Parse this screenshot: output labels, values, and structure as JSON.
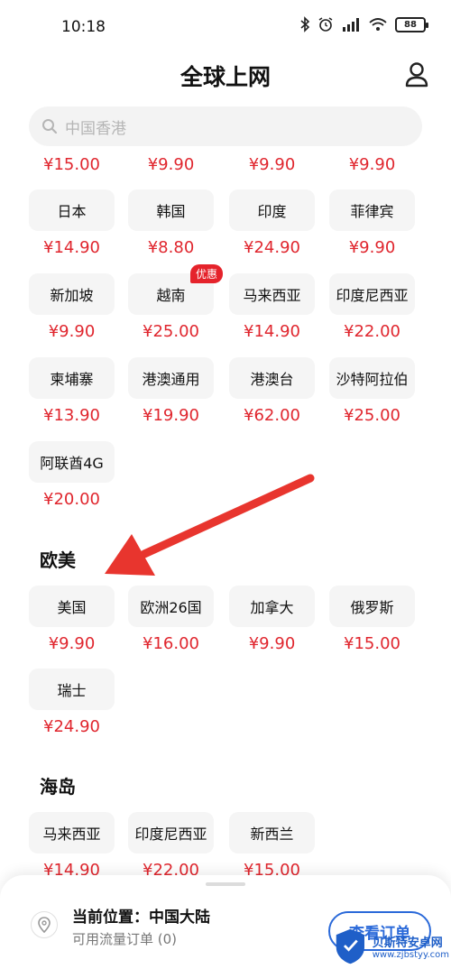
{
  "status_bar": {
    "time": "10:18",
    "battery": "88"
  },
  "header": {
    "title": "全球上网"
  },
  "search": {
    "placeholder": "中国香港"
  },
  "top_prices": [
    "¥15.00",
    "¥9.90",
    "¥9.90",
    "¥9.90"
  ],
  "asia_rows": [
    [
      {
        "name": "日本",
        "price": "¥14.90"
      },
      {
        "name": "韩国",
        "price": "¥8.80"
      },
      {
        "name": "印度",
        "price": "¥24.90"
      },
      {
        "name": "菲律宾",
        "price": "¥9.90"
      }
    ],
    [
      {
        "name": "新加坡",
        "price": "¥9.90"
      },
      {
        "name": "越南",
        "price": "¥25.00",
        "badge": "优惠"
      },
      {
        "name": "马来西亚",
        "price": "¥14.90"
      },
      {
        "name": "印度尼西亚",
        "price": "¥22.00"
      }
    ],
    [
      {
        "name": "柬埔寨",
        "price": "¥13.90"
      },
      {
        "name": "港澳通用",
        "price": "¥19.90"
      },
      {
        "name": "港澳台",
        "price": "¥62.00"
      },
      {
        "name": "沙特阿拉伯",
        "price": "¥25.00"
      }
    ],
    [
      {
        "name": "阿联酋4G",
        "price": "¥20.00"
      }
    ]
  ],
  "europe": {
    "title": "欧美",
    "rows": [
      [
        {
          "name": "美国",
          "price": "¥9.90"
        },
        {
          "name": "欧洲26国",
          "price": "¥16.00"
        },
        {
          "name": "加拿大",
          "price": "¥9.90"
        },
        {
          "name": "俄罗斯",
          "price": "¥15.00"
        }
      ],
      [
        {
          "name": "瑞士",
          "price": "¥24.90"
        }
      ]
    ]
  },
  "islands": {
    "title": "海岛",
    "rows": [
      [
        {
          "name": "马来西亚",
          "price": "¥14.90"
        },
        {
          "name": "印度尼西亚",
          "price": "¥22.00"
        },
        {
          "name": "新西兰",
          "price": "¥15.00"
        }
      ]
    ]
  },
  "bottom": {
    "location": "当前位置：中国大陆",
    "orders": "可用流量订单 (0)",
    "button": "查看订单"
  },
  "watermark": {
    "name": "贝斯特安卓网",
    "url": "www.zjbstyy.com"
  },
  "colors": {
    "price": "#e0262e",
    "accent": "#2a69d9",
    "badge": "#e5232b",
    "arrow": "#e8352e"
  }
}
